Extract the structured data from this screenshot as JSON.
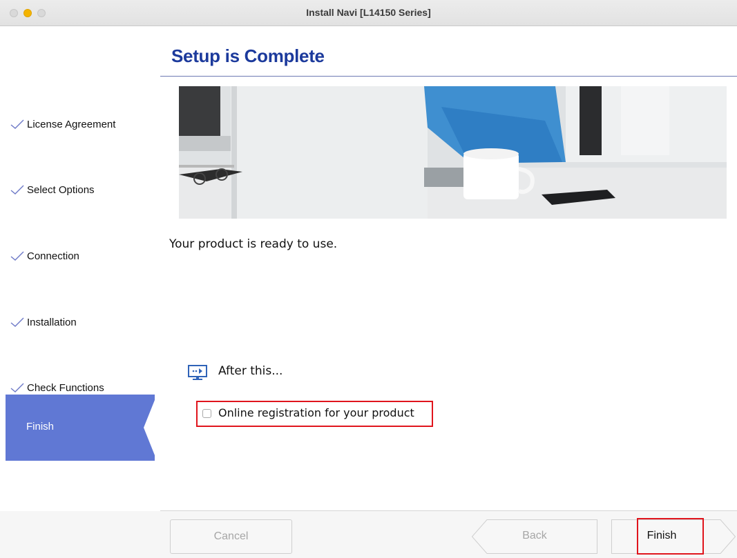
{
  "window": {
    "title": "Install Navi [L14150 Series]"
  },
  "sidebar": {
    "steps": [
      {
        "label": "License Agreement",
        "status": "done"
      },
      {
        "label": "Select Options",
        "status": "done"
      },
      {
        "label": "Connection",
        "status": "done"
      },
      {
        "label": "Installation",
        "status": "done"
      },
      {
        "label": "Check Functions",
        "status": "done"
      },
      {
        "label": "Finish",
        "status": "current"
      }
    ],
    "active_color": "#6078d4",
    "check_color": "#6d79c7"
  },
  "main": {
    "heading": "Setup is Complete",
    "heading_color": "#1c3a9c",
    "message": "Your product is ready to use.",
    "after": {
      "title": "After this...",
      "icon": "display-arrow-icon",
      "option_label": "Online registration for your product",
      "option_checked": false
    },
    "highlight_color": "#e0141c"
  },
  "footer": {
    "cancel_label": "Cancel",
    "back_label": "Back",
    "finish_label": "Finish"
  }
}
